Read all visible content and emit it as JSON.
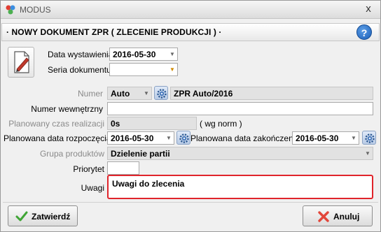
{
  "window": {
    "title": "MODUS",
    "close_glyph": "x"
  },
  "header": {
    "heading": "· NOWY DOKUMENT ZPR ( ZLECENIE PRODUKCJI ) ·",
    "help_glyph": "?"
  },
  "form": {
    "data_wystawienia": {
      "label": "Data wystawienia",
      "value": "2016-05-30"
    },
    "seria_dokumentu": {
      "label": "Seria dokumentu",
      "value": ""
    },
    "numer": {
      "label": "Numer",
      "mode": "Auto",
      "value": "ZPR Auto/2016"
    },
    "numer_wewnetrzny": {
      "label": "Numer wewnętrzny",
      "value": ""
    },
    "planowany_czas": {
      "label": "Planowany czas realizacji",
      "value": "0s",
      "suffix": "( wg norm )"
    },
    "planowana_data_rozpoczecia": {
      "label": "Planowana data rozpoczęcia",
      "value": "2016-05-30"
    },
    "planowana_data_zakonczenia": {
      "label": "Planowana data zakończenia",
      "value": "2016-05-30"
    },
    "grupa_produktow": {
      "label": "Grupa produktów",
      "value": "Dzielenie partii"
    },
    "priorytet": {
      "label": "Priorytet",
      "value": ""
    },
    "uwagi": {
      "label": "Uwagi",
      "value": "Uwagi do zlecenia"
    }
  },
  "buttons": {
    "confirm": "Zatwierdź",
    "cancel": "Anuluj"
  },
  "colors": {
    "uwagi_border": "#e0242b",
    "help_button": "#1b5fb8"
  },
  "icons": [
    "app-icon",
    "close-icon",
    "help-icon",
    "document-edit-icon",
    "gear-icon",
    "dropdown-arrow-icon",
    "checkmark-icon",
    "cancel-x-icon"
  ]
}
